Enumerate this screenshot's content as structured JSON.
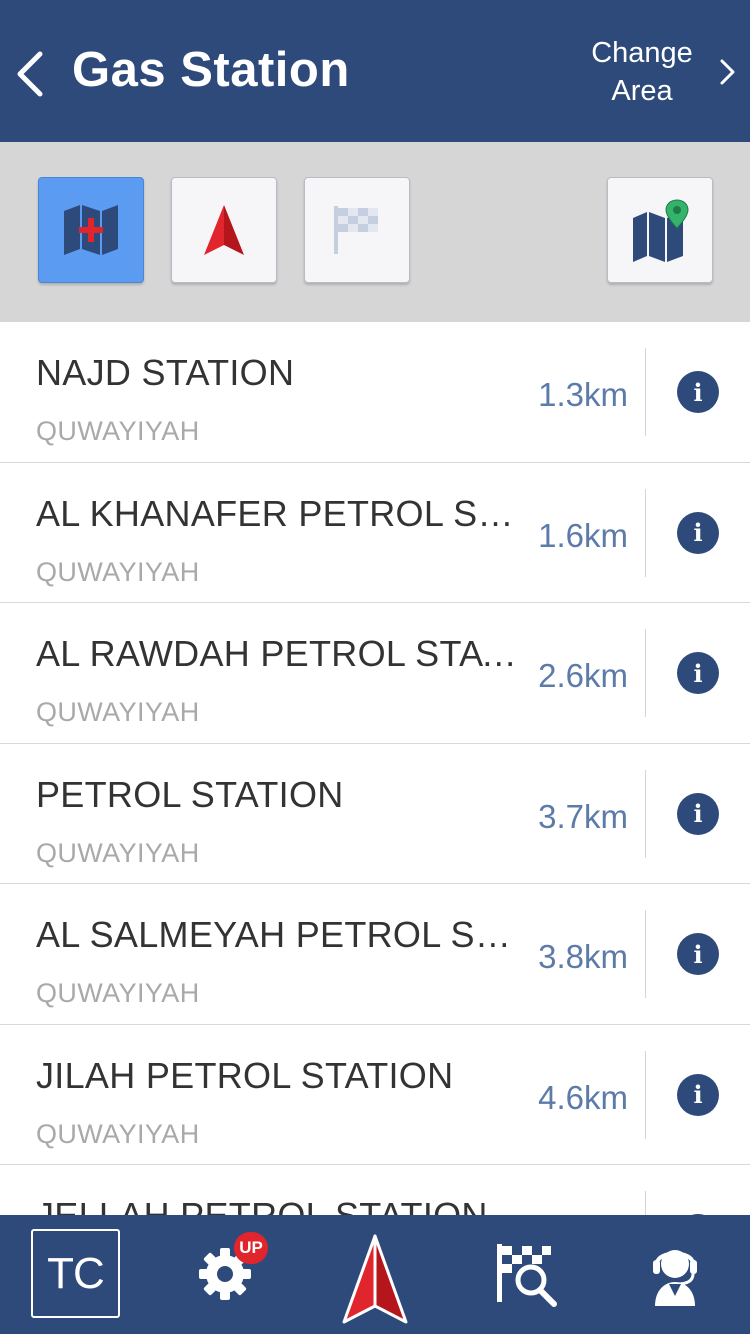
{
  "header": {
    "title": "Gas Station",
    "change_area_line1": "Change",
    "change_area_line2": "Area",
    "back_icon": "chevron-left-icon",
    "forward_icon": "chevron-right-icon"
  },
  "toolbar": {
    "buttons": [
      {
        "icon": "map-add-icon",
        "active": true
      },
      {
        "icon": "navigation-arrow-icon",
        "active": false
      },
      {
        "icon": "checkered-flag-icon",
        "active": false
      },
      {
        "icon": "map-pin-icon",
        "active": false
      }
    ]
  },
  "stations": [
    {
      "name": "NAJD STATION",
      "area": "QUWAYIYAH",
      "distance": "1.3km"
    },
    {
      "name": "AL KHANAFER PETROL STATION",
      "area": "QUWAYIYAH",
      "distance": "1.6km"
    },
    {
      "name": "AL RAWDAH PETROL STATION",
      "area": "QUWAYIYAH",
      "distance": "2.6km"
    },
    {
      "name": "PETROL STATION",
      "area": "QUWAYIYAH",
      "distance": "3.7km"
    },
    {
      "name": "AL SALMEYAH PETROL STATION",
      "area": "QUWAYIYAH",
      "distance": "3.8km"
    },
    {
      "name": "JILAH PETROL STATION",
      "area": "QUWAYIYAH",
      "distance": "4.6km"
    },
    {
      "name": "JELLAH PETROL STATION",
      "area": "",
      "distance": ""
    }
  ],
  "info_label": "i",
  "bottom_nav": {
    "tc_label": "TC",
    "settings_badge": "UP",
    "items": [
      "tc-icon",
      "settings-icon",
      "navigation-arrow-icon",
      "destination-search-icon",
      "support-agent-icon"
    ]
  },
  "colors": {
    "header_bg": "#2d4a7a",
    "toolbar_bg": "#d6d6d6",
    "active_button": "#5b9cf2",
    "distance_text": "#5c7ba8",
    "accent_red": "#e0262c"
  }
}
